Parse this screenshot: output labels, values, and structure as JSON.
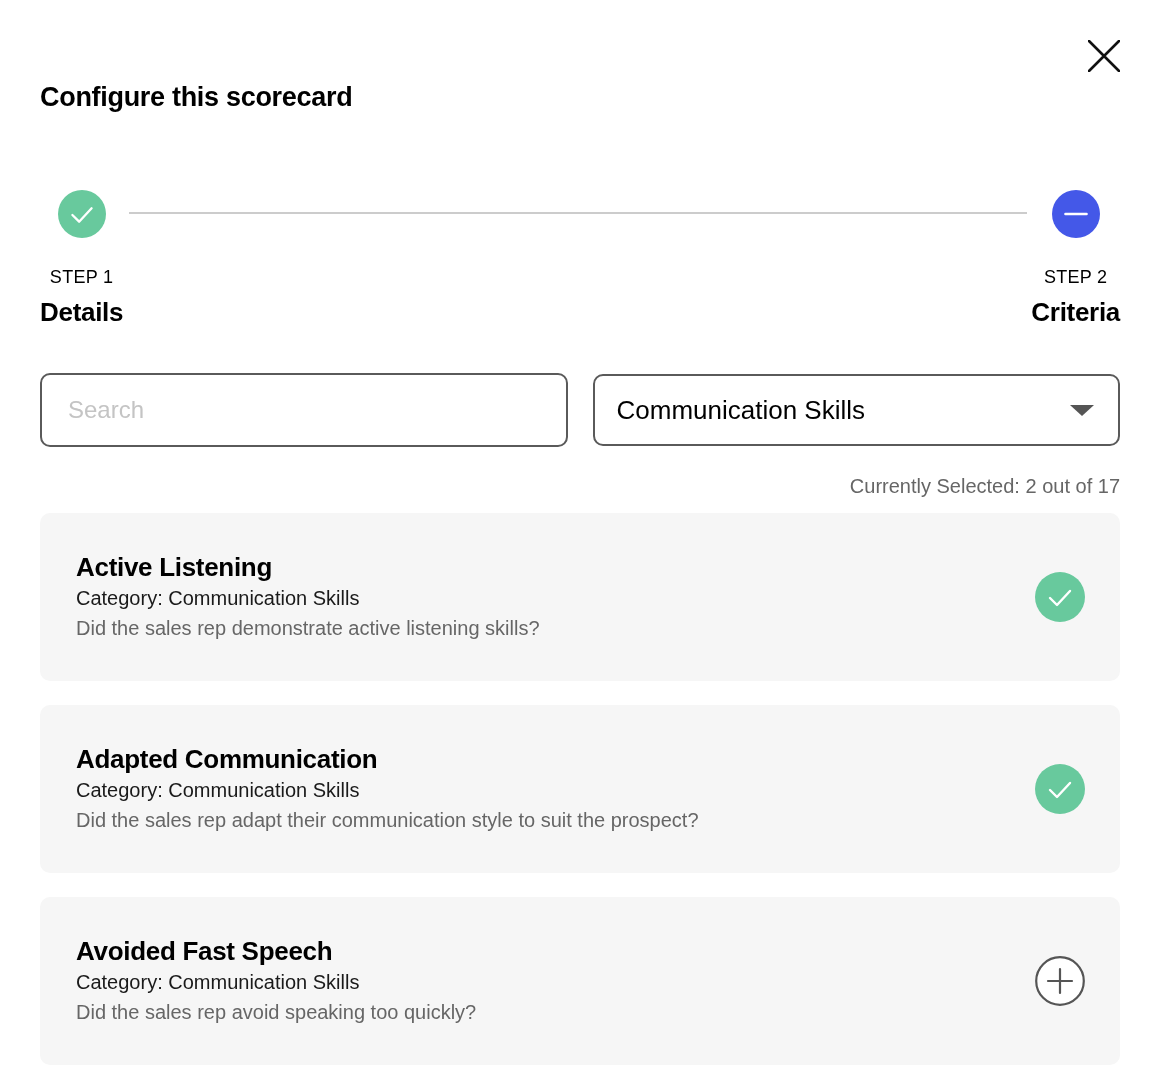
{
  "dialog": {
    "title": "Configure this scorecard"
  },
  "steps": [
    {
      "label": "STEP 1",
      "name": "Details",
      "completed": true
    },
    {
      "label": "STEP 2",
      "name": "Criteria",
      "completed": false
    }
  ],
  "search": {
    "placeholder": "Search"
  },
  "category_filter": {
    "value": "Communication Skills"
  },
  "selection_count": "Currently Selected: 2 out of 17",
  "criteria": [
    {
      "title": "Active Listening",
      "category": "Category: Communication Skills",
      "description": "Did the sales rep demonstrate active listening skills?",
      "selected": true
    },
    {
      "title": "Adapted Communication",
      "category": "Category: Communication Skills",
      "description": "Did the sales rep adapt their communication style to suit the prospect?",
      "selected": true
    },
    {
      "title": "Avoided Fast Speech",
      "category": "Category: Communication Skills",
      "description": "Did the sales rep avoid speaking too quickly?",
      "selected": false
    }
  ]
}
